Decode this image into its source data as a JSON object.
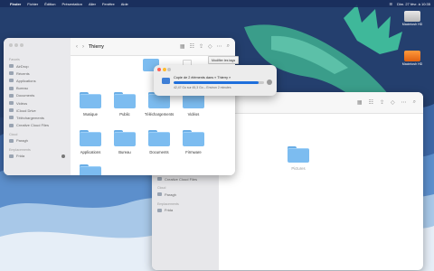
{
  "menubar": {
    "items": [
      "Finder",
      "Fichier",
      "Édition",
      "Présentation",
      "Aller",
      "Fenêtre",
      "Aide"
    ],
    "clock": "Dim. 27 févr. à 10:35"
  },
  "desktop": {
    "disks": [
      {
        "label": "Macintosh HD"
      },
      {
        "label": "Macintosh HD"
      }
    ]
  },
  "front_window": {
    "title": "Thierry",
    "sidebar": {
      "sections": [
        {
          "title": "Favoris",
          "items": [
            "AirDrop",
            "Récents",
            "Applications",
            "Bureau",
            "Documents",
            "Vidéos",
            "iCloud Drive",
            "Téléchargements",
            "Creative Cloud Files"
          ]
        },
        {
          "title": "Cloud",
          "items": [
            "Paragh"
          ]
        },
        {
          "title": "Emplacements",
          "items": [
            "Frida"
          ]
        }
      ]
    },
    "folders": [
      "Musique",
      "Public",
      "Téléchargements",
      "Vidéos",
      "Applications",
      "Bureau",
      "Documents",
      "Firmware"
    ]
  },
  "copy_dialog": {
    "message": "Copie de 2 éléments dans « Thierry »",
    "detail": "42,47 Go sur 45,3 Go – Environ 2 minutes",
    "progress": 0.94,
    "tooltip": "Modifier les tags"
  },
  "back_window": {
    "sidebar_items": [
      "Téléchargements",
      "Creative Cloud Files"
    ],
    "cloud_title": "Cloud",
    "cloud_item": "Paragh",
    "places_title": "Emplacements",
    "places_item": "Frida",
    "folder": "Pictures"
  },
  "colors": {
    "accent": "#1e6fdc",
    "folder": "#7cbcf0",
    "sidebar": "#e9e9ec"
  }
}
